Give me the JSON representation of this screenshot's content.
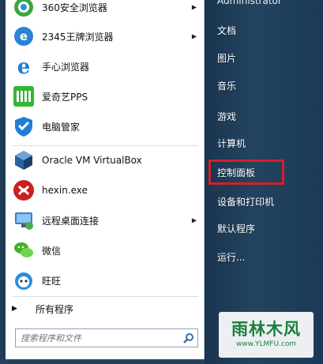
{
  "programs": [
    {
      "label": "360安全浏览器",
      "icon": "360-browser-icon",
      "arrow": true
    },
    {
      "label": "2345王牌浏览器",
      "icon": "2345-browser-icon",
      "arrow": true
    },
    {
      "label": "手心浏览器",
      "icon": "shouxin-browser-icon",
      "arrow": false
    },
    {
      "label": "爱奇艺PPS",
      "icon": "iqiyi-icon",
      "arrow": false
    },
    {
      "label": "电脑管家",
      "icon": "pc-manager-icon",
      "arrow": false
    },
    {
      "label": "Oracle VM VirtualBox",
      "icon": "virtualbox-icon",
      "arrow": false
    },
    {
      "label": "hexin.exe",
      "icon": "hexin-icon",
      "arrow": false
    },
    {
      "label": "远程桌面连接",
      "icon": "remote-desktop-icon",
      "arrow": true
    },
    {
      "label": "微信",
      "icon": "wechat-icon",
      "arrow": false
    },
    {
      "label": "旺旺",
      "icon": "wangwang-icon",
      "arrow": false
    }
  ],
  "all_programs": "所有程序",
  "search": {
    "placeholder": "搜索程序和文件"
  },
  "right_panel": {
    "user": "Administrator",
    "items": [
      "文档",
      "图片",
      "音乐",
      "游戏",
      "计算机",
      "控制面板",
      "设备和打印机",
      "默认程序",
      "运行..."
    ]
  },
  "watermark": {
    "brand": "雨林木风",
    "url": "www.YLMFU.com"
  },
  "colors": {
    "highlight": "#d41f2a",
    "right_panel": "#1f3a55",
    "watermark": "#1b7f3d"
  }
}
